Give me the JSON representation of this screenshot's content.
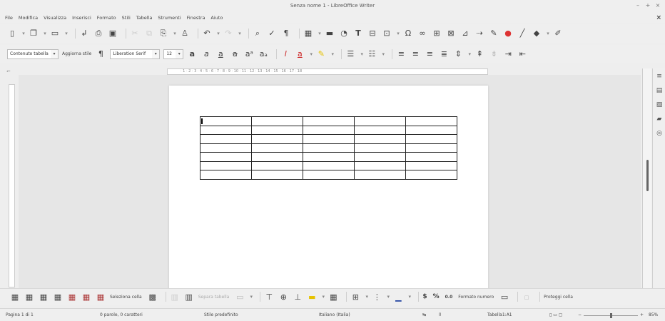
{
  "window": {
    "title": "Senza nome 1 - LibreOffice Writer"
  },
  "menu": [
    "File",
    "Modifica",
    "Visualizza",
    "Inserisci",
    "Formato",
    "Stili",
    "Tabella",
    "Strumenti",
    "Finestra",
    "Aiuto"
  ],
  "formatting": {
    "paragraph_style": "Contenuto tabella",
    "update_style_label": "Aggiorna stile",
    "font_name": "Liberation Serif",
    "font_size": "12"
  },
  "table_toolbar": {
    "select_cell": "Seleziona cella",
    "split_table": "Separa tabella",
    "number_format": "Formato numero",
    "number_format_value": "0.0",
    "percent": "%",
    "currency": "$",
    "protect_cell": "Proteggi cella"
  },
  "status": {
    "page": "Pagina 1 di 1",
    "words": "0 parole, 0 caratteri",
    "page_style": "Stile predefinito",
    "language": "Italiano (Italia)",
    "table_cell": "Tabella1:A1",
    "zoom": "85%"
  },
  "document": {
    "table_rows": 7,
    "table_cols": 5
  }
}
